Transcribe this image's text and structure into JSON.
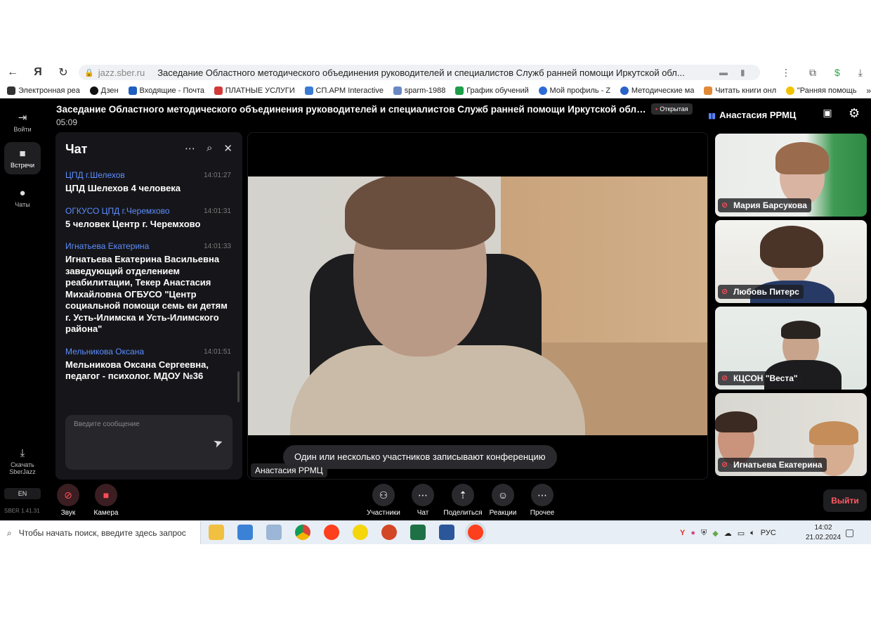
{
  "browser": {
    "domain": "jazz.sber.ru",
    "page_title": "Заседание Областного методического объединения руководителей и специалистов Служб ранней помощи Иркутской обл...",
    "bookmarks": [
      {
        "label": "Электронная реа",
        "color": "#333333"
      },
      {
        "label": "Дзен",
        "color": "#111111"
      },
      {
        "label": "Входящие - Почта",
        "color": "#1f5fbf"
      },
      {
        "label": "ПЛАТНЫЕ УСЛУГИ",
        "color": "#d23a3a"
      },
      {
        "label": "СП.АРМ Interactive",
        "color": "#3a7bd5"
      },
      {
        "label": "sparm-1988",
        "color": "#6a88c4"
      },
      {
        "label": "График обучений",
        "color": "#1e9e4a"
      },
      {
        "label": "Мой профиль - Z",
        "color": "#2d6bd6"
      },
      {
        "label": "Методические ма",
        "color": "#2b64c8"
      },
      {
        "label": "Читать книги онл",
        "color": "#e08a36"
      },
      {
        "label": "\"Ранняя помощь",
        "color": "#f2c200"
      }
    ]
  },
  "app": {
    "meeting_title": "Заседание Областного методического объединения руководителей и специалистов Служб ранней помощи Иркутской обла...",
    "open_badge": "Открытая",
    "timer": "05:09",
    "user_name": "Анастасия РРМЦ",
    "rail": {
      "enter": "Войти",
      "meetings": "Встречи",
      "chats": "Чаты",
      "download": "Скачать SberJazz",
      "lang": "EN",
      "version": "SBER 1.41.31"
    }
  },
  "chat": {
    "title": "Чат",
    "messages": [
      {
        "author": "ЦПД г.Шелехов",
        "time": "14:01:27",
        "text": "ЦПД Шелехов 4 человека"
      },
      {
        "author": "ОГКУСО ЦПД г.Черемхово",
        "time": "14:01:31",
        "text": "5 человек Центр г. Черемхово"
      },
      {
        "author": "Игнатьева Екатерина",
        "time": "14:01:33",
        "text": "Игнатьева Екатерина Васильевна заведующий отделением реабилитации, Текер Анастасия Михайловна ОГБУСО \"Центр социальной помощи семь еи детям г. Усть-Илимска и Усть-Илимского района\""
      },
      {
        "author": "Мельникова Оксана",
        "time": "14:01:51",
        "text": "Мельникова Оксана Сергеевна, педагог - психолог. МДОУ №36"
      }
    ],
    "input_placeholder": "Введите сообщение"
  },
  "main_video": {
    "speaker_label": "Анастасия РРМЦ",
    "recording_banner": "Один или несколько участников записывают конференцию"
  },
  "participants": [
    {
      "name": "Мария Барсукова",
      "muted": true
    },
    {
      "name": "Любовь Питерс",
      "muted": true
    },
    {
      "name": "КЦСОН \"Веста\"",
      "muted": true
    },
    {
      "name": "Игнатьева Екатерина",
      "muted": true
    }
  ],
  "controls": {
    "sound": "Звук",
    "camera": "Камера",
    "participants": "Участники",
    "chat": "Чат",
    "share": "Поделиться",
    "reactions": "Реакции",
    "more": "Прочее",
    "leave": "Выйти"
  },
  "taskbar": {
    "search_placeholder": "Чтобы начать поиск, введите здесь запрос",
    "lang": "РУС",
    "time": "14:02",
    "date": "21.02.2024"
  }
}
